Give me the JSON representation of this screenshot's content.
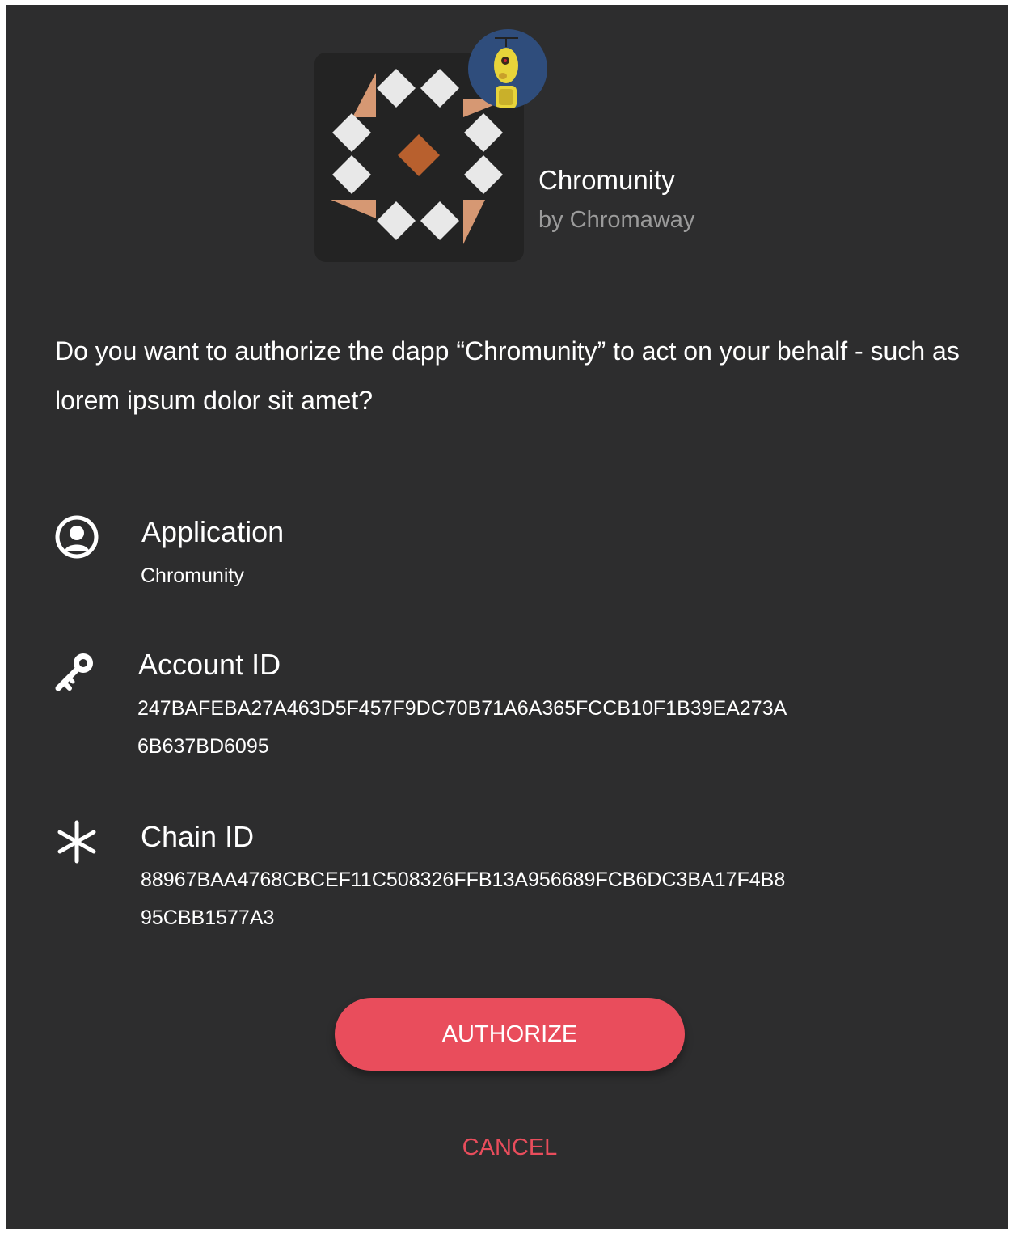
{
  "app": {
    "name": "Chromunity",
    "publisher": "by Chromaway"
  },
  "prompt": {
    "question": "Do you want to authorize the dapp “Chromunity” to act on your behalf - such as lorem ipsum dolor sit amet?"
  },
  "details": {
    "application": {
      "icon": "user-circle-icon",
      "title": "Application",
      "value": "Chromunity"
    },
    "account": {
      "icon": "key-icon",
      "title": "Account ID",
      "value_line1": "247BAFEBA27A463D5F457F9DC70B71A6A365FCCB10F1B39EA273A",
      "value_line2": "6B637BD6095"
    },
    "chain": {
      "icon": "asterisk-icon",
      "title": "Chain ID",
      "value_line1": "88967BAA4768CBCEF11C508326FFB13A956689FCB6DC3BA17F4B8",
      "value_line2": "95CBB1577A3"
    }
  },
  "actions": {
    "authorize_label": "AUTHORIZE",
    "cancel_label": "CANCEL"
  },
  "colors": {
    "background": "#2d2d2e",
    "accent": "#e94d5c",
    "secondary_text": "#9b9b9b",
    "logo_tile": "#232323",
    "logo_peach": "#d69873",
    "logo_rust": "#b8602e"
  }
}
